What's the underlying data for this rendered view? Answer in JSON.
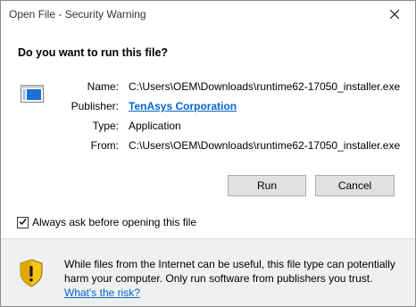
{
  "window": {
    "title": "Open File - Security Warning"
  },
  "dialog": {
    "heading": "Do you want to run this file?",
    "fields": [
      {
        "label": "Name:",
        "value": "C:\\Users\\OEM\\Downloads\\runtime62-17050_installer.exe"
      },
      {
        "label": "Publisher:",
        "value": "TenAsys Corporation"
      },
      {
        "label": "Type:",
        "value": "Application"
      },
      {
        "label": "From:",
        "value": "C:\\Users\\OEM\\Downloads\\runtime62-17050_installer.exe"
      }
    ],
    "buttons": {
      "run": "Run",
      "cancel": "Cancel"
    },
    "checkbox": {
      "label": "Always ask before opening this file",
      "checked": true
    },
    "warning": {
      "text": "While files from the Internet can be useful, this file type can potentially harm your computer. Only run software from publishers you trust.",
      "link": "What's the risk?"
    }
  },
  "icons": {
    "close": "close-icon",
    "file": "application-file-icon",
    "shield": "security-shield-icon",
    "check": "checkmark-icon"
  },
  "colors": {
    "link": "#0066cc",
    "button_bg": "#e1e1e1",
    "footer_bg": "#f0f0f0",
    "shield_yellow": "#f5c518",
    "file_icon_blue": "#1e6fd6"
  }
}
